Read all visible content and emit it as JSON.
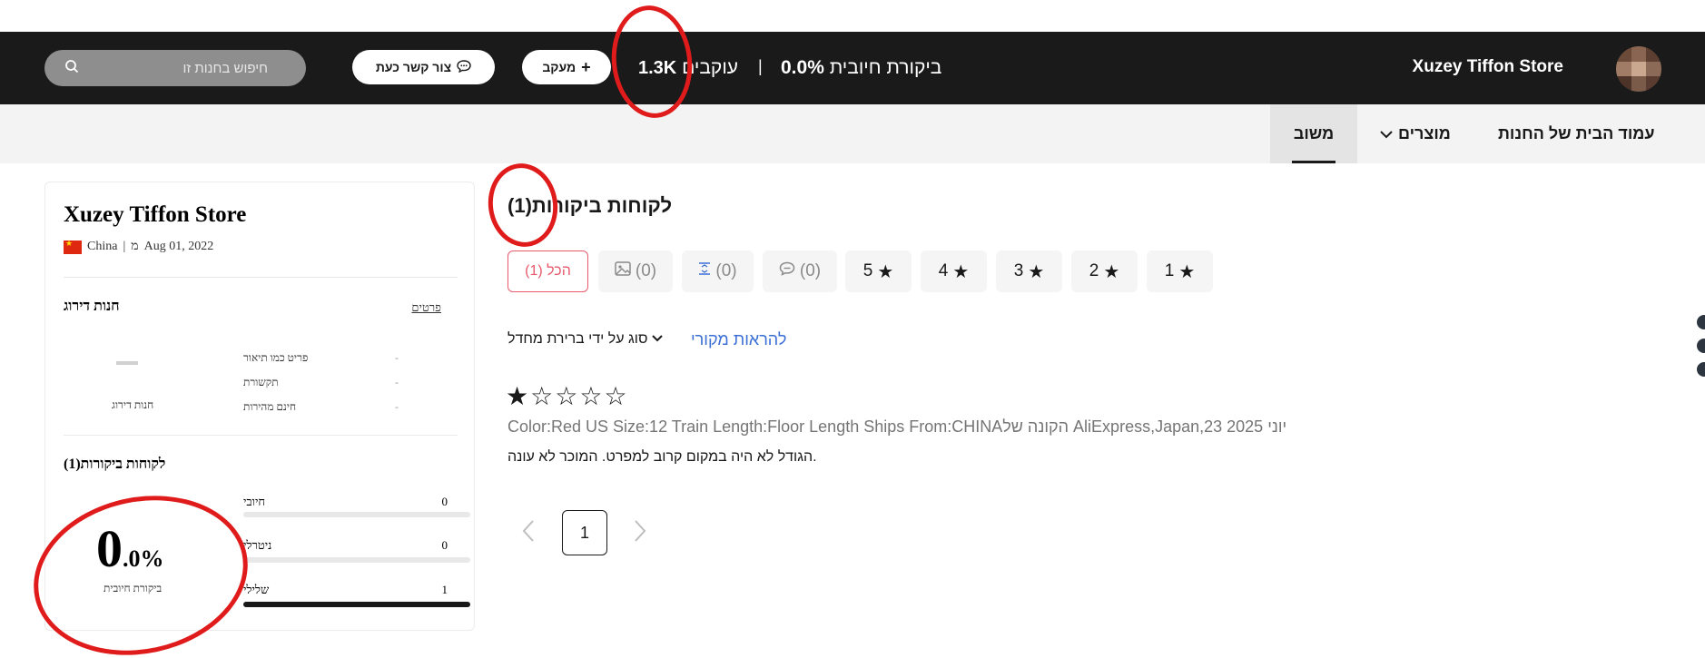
{
  "header": {
    "store_name": "Xuzey Tiffon Store",
    "rating_label": "ביקורת חיובית",
    "rating_value": "0.0%",
    "separator": "|",
    "followers_label": "עוקבים",
    "followers_value": "1.3K",
    "follow_label": "מעקב",
    "contact_label": "צור קשר כעת",
    "search_placeholder": "חיפוש בחנות זו"
  },
  "nav": {
    "home": "עמוד הבית של החנות",
    "products": "מוצרים",
    "feedback": "משוב"
  },
  "sidebar": {
    "store_title": "Xuzey Tiffon Store",
    "country": "China",
    "meta_sep": "|",
    "since_prefix": "מ",
    "since_date": "Aug 01, 2022",
    "rating_title": "חנות דירוג",
    "details_link": "פרטים",
    "rating_sub": "חנות דירוג",
    "dsr": [
      {
        "label": "פריט כמו תיאור",
        "value": "-"
      },
      {
        "label": "תקשורת",
        "value": "-"
      },
      {
        "label": "חינם מהירות",
        "value": "-"
      }
    ],
    "feedback_title": "לקוחות ביקורות(1)",
    "feedback_rows": [
      {
        "label": "חיובי",
        "count": "0",
        "fraction": 0
      },
      {
        "label": "ניטרלי",
        "count": "0",
        "fraction": 0
      },
      {
        "label": "שלילי",
        "count": "1",
        "fraction": 1
      }
    ],
    "percent_big": "0",
    "percent_small": ".0%",
    "percent_label": "ביקורת חיובית"
  },
  "main": {
    "title": "לקוחות ביקורות(1)",
    "filters": {
      "all": "הכל (1)",
      "photo_count": "(0)",
      "video_count": "(0)",
      "comment_count": "(0)",
      "star5": "5",
      "star4": "4",
      "star3": "3",
      "star2": "2",
      "star1": "1"
    },
    "sort_label": "סוג על ידי ברירת מחדל",
    "translate_label": "להראות מקורי",
    "review": {
      "stars": 1,
      "meta": "Color:Red US Size:12 Train Length:Floor Length Ships From:CHINAהקונה של AliExpress,Japan,23 יוני 2025",
      "text": "הגודל לא היה במקום קרוב למפרט. המוכר לא עונה."
    },
    "pager": {
      "current": "1"
    }
  },
  "colors": {
    "header_bg": "#1a1a1a",
    "nav_bg": "#f3f3f3",
    "active_filter": "#e85a6c",
    "link": "#3b6fd6",
    "annotation": "#e01b1b"
  }
}
